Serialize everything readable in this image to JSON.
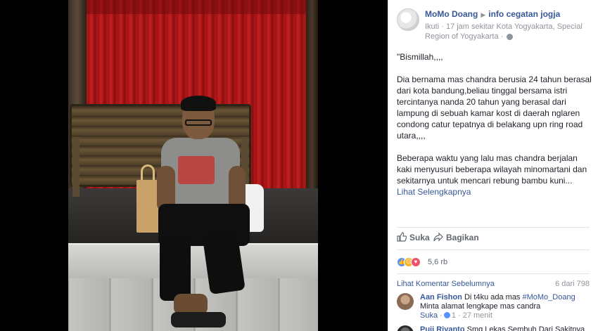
{
  "post": {
    "author": "MoMo Doang",
    "group": "info cegatan jogja",
    "meta_line": "Ikuti · 17 jam sekitar Kota Yogyakarta, Special Region of Yogyakarta ·",
    "paragraphs": [
      "\"Bismillah,,,,",
      "Dia bernama mas chandra berusia 24 tahun berasal dari kota bandung,beliau tinggal bersama istri tercintanya nanda 20 tahun yang berasal dari lampung di sebuah kamar kost di daerah nglaren condong catur tepatnya di belakang upn ring road utara,,,,",
      "Beberapa waktu yang lalu mas chandra berjalan kaki menyusuri beberapa wilayah minomartani dan sekitarnya untuk mencari rebung bambu kuni..."
    ],
    "see_more": "Lihat Selengkapnya"
  },
  "actions": {
    "like": "Suka",
    "share": "Bagikan"
  },
  "reactions": {
    "count": "5,6 rb",
    "icons": [
      "like-reaction-icon",
      "sad-reaction-icon",
      "love-reaction-icon"
    ],
    "colors": {
      "like": "#5890ff",
      "sad": "#f7b125",
      "love": "#f25268"
    }
  },
  "comments": {
    "previous_link": "Lihat Komentar Sebelumnya",
    "count": "6 dari 798",
    "items": [
      {
        "author": "Aan Fishon",
        "text_before": "Di t4ku ada mas",
        "tag": "#MoMo_Doang",
        "text_line2": "Minta alamat lengkape mas candra",
        "like_label": "Suka",
        "like_count": "1",
        "time": "27 menit"
      },
      {
        "author": "Puji Riyanto",
        "text_before": "Smg Lekas Sembuh Dari Sakitnya ya"
      }
    ]
  },
  "colors": {
    "link": "#365899",
    "muted": "#90949c",
    "text": "#1d2129"
  }
}
